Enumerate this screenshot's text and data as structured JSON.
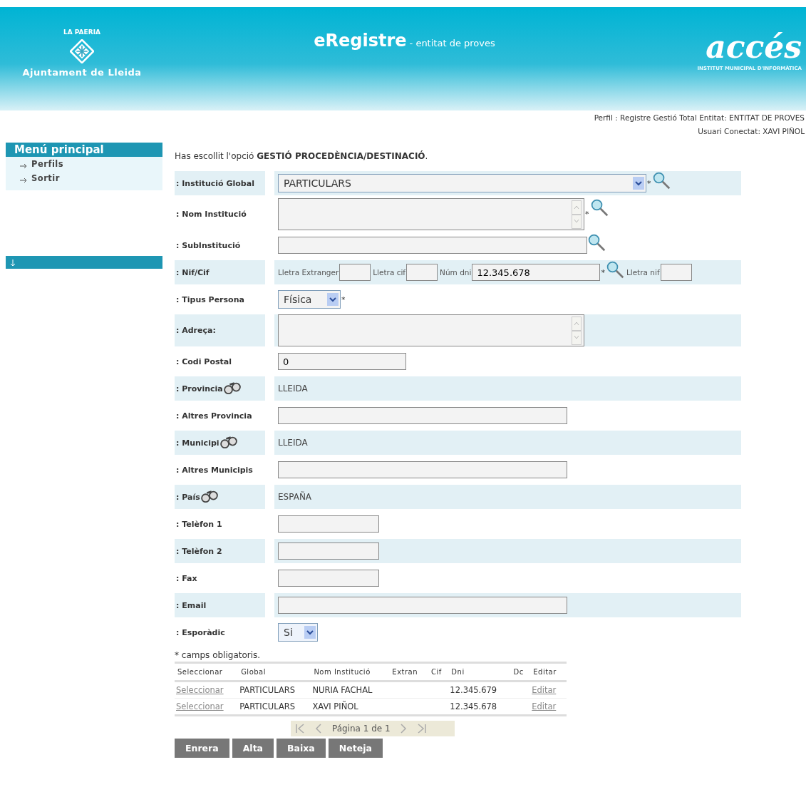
{
  "header": {
    "org_top": "LA PAERIA",
    "org_name": "Ajuntament de Lleida",
    "app_title": "eRegistre",
    "app_subtitle": "- entitat de proves",
    "brand": "accés",
    "brand_sub": "INSTITUT MUNICIPAL D'INFORMÀTICA"
  },
  "session": [
    "Perfil : Registre Gestió Total Entitat: ENTITAT DE PROVES",
    "Usuari Conectat: XAVI PIÑOL"
  ],
  "sidebar": {
    "title": "Menú principal",
    "items": [
      {
        "label": "Perfils"
      },
      {
        "label": "Sortir"
      }
    ]
  },
  "intro": "Has escollit l'opció **GESTIÓ PROCEDÈNCIA/DESTINACIÓ**.",
  "form": [
    {
      "label": ": Institució Global",
      "kind": "select",
      "value": "PARTICULARS",
      "required_mark": "*",
      "search": true
    },
    {
      "label": ": Nom Institució",
      "kind": "textarea",
      "required_mark": "*",
      "search": true
    },
    {
      "label": ": SubInstitució",
      "kind": "input",
      "search": true
    },
    {
      "label": ": Nif/Cif",
      "kind": "nif",
      "parts": [
        {
          "label": "Lletra Extranger"
        },
        {
          "label": "Lletra cif"
        },
        {
          "label": "Núm dni",
          "value": "12.345.678",
          "required_mark": "*",
          "search": true
        },
        {
          "label": "Lletra nif"
        }
      ]
    },
    {
      "label": ": Tipus Persona",
      "kind": "select",
      "value": "Física",
      "required_mark": "*"
    },
    {
      "label": ": Adreça:",
      "kind": "textarea"
    },
    {
      "label": ": Codi Postal",
      "kind": "input",
      "value": "0"
    },
    {
      "label": ": Provincia",
      "kind": "text",
      "lookup": true,
      "value": "LLEIDA"
    },
    {
      "label": ": Altres Provincia",
      "kind": "input"
    },
    {
      "label": ": Municipi",
      "kind": "text",
      "lookup": true,
      "value": "LLEIDA"
    },
    {
      "label": ": Altres Municipis",
      "kind": "input"
    },
    {
      "label": ": País",
      "kind": "text",
      "lookup": true,
      "value": "ESPAÑA"
    },
    {
      "label": ": Telèfon 1",
      "kind": "input"
    },
    {
      "label": ": Telèfon 2",
      "kind": "input"
    },
    {
      "label": ": Fax",
      "kind": "input"
    },
    {
      "label": ": Email",
      "kind": "input"
    },
    {
      "label": ": Esporàdic",
      "kind": "select",
      "value": "Si"
    }
  ],
  "note": "* camps obligatoris.",
  "table": {
    "columns": [
      "Seleccionar",
      "Global",
      "Nom Institució",
      "Extran",
      "Cif",
      "Dni",
      "Dc",
      "Editar"
    ],
    "rows": [
      [
        "Seleccionar",
        "PARTICULARS",
        "NURIA FACHAL",
        "",
        "",
        "12.345.679",
        "",
        "Editar"
      ],
      [
        "Seleccionar",
        "PARTICULARS",
        "XAVI PIÑOL",
        "",
        "",
        "12.345.678",
        "",
        "Editar"
      ]
    ]
  },
  "pager": "Página 1 de 1",
  "buttons": [
    "Enrera",
    "Alta",
    "Baixa",
    "Neteja"
  ]
}
